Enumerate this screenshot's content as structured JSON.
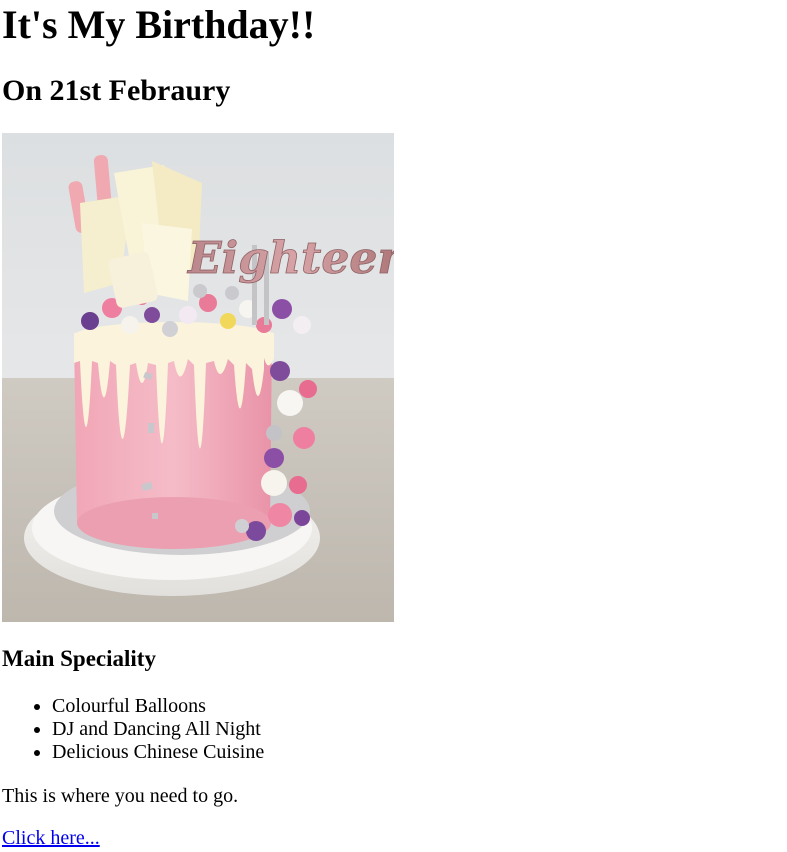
{
  "header": {
    "title": "It's My Birthday!!",
    "subtitle": "On 21st Febraury"
  },
  "image": {
    "topper_text": "Eighteen"
  },
  "section": {
    "heading": "Main Speciality",
    "items": [
      "Colourful Balloons",
      "DJ and Dancing All Night",
      "Delicious Chinese Cuisine"
    ]
  },
  "footer": {
    "note": "This is where you need to go.",
    "link_label": "Click here..."
  },
  "colors": {
    "link": "#0000ee",
    "cake_pink": "#f2a9b9",
    "drip_cream": "#fbf3dc",
    "background_wall": "#d9dcde",
    "table": "#c9c4bb"
  }
}
